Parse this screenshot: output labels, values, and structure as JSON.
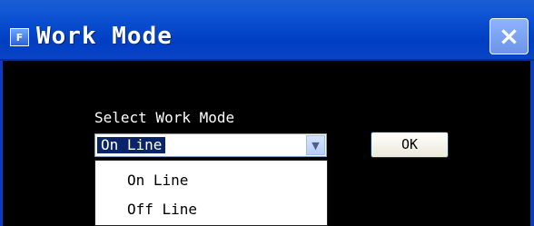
{
  "window": {
    "title": "Work Mode",
    "icon": "app-icon",
    "close_icon": "×"
  },
  "form": {
    "label": "Select Work Mode",
    "select_value": "On Line",
    "dropdown_arrow_icon": "▼",
    "options": [
      "On Line",
      "Off Line"
    ],
    "ok_label": "OK"
  },
  "colors": {
    "titlebar": "#0a4fd0",
    "background": "#000000",
    "selected_option": "#0a246a"
  }
}
